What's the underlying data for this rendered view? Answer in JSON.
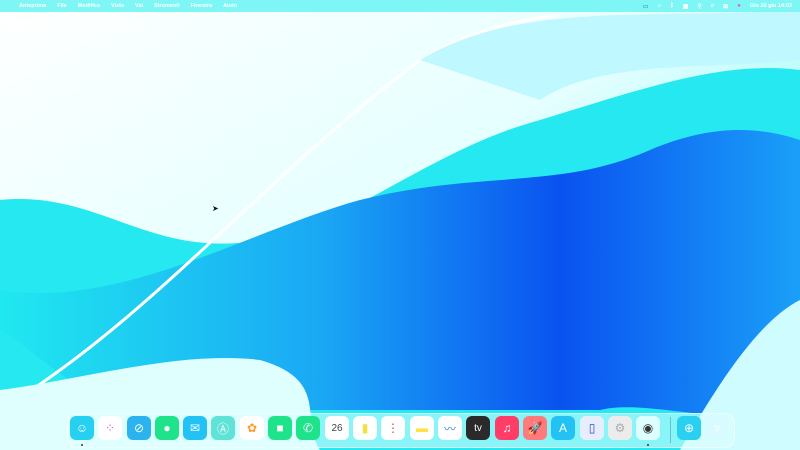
{
  "menubar": {
    "app_name": "Anteprima",
    "items": [
      "File",
      "Modifica",
      "Vista",
      "Vai",
      "Strumenti",
      "Finestra",
      "Aiuto"
    ],
    "clock": "Gio 26 giu  14:03",
    "status_icons": [
      "display-icon",
      "home-icon",
      "bluetooth-icon",
      "battery-icon",
      "wifi-icon",
      "search-icon",
      "control-center-icon",
      "siri-icon"
    ]
  },
  "dock": {
    "apps": [
      {
        "name": "Finder",
        "icon": "☺",
        "bg": "#26d0f0",
        "running": true
      },
      {
        "name": "Launchpad",
        "icon": "⁘",
        "bg": "#ffffff",
        "fg": "#e04fe0"
      },
      {
        "name": "Safari",
        "icon": "⊘",
        "bg": "#2ab3ef"
      },
      {
        "name": "Messaggi",
        "icon": "●",
        "bg": "#1fe38a"
      },
      {
        "name": "Mail",
        "icon": "✉",
        "bg": "#22c3f4"
      },
      {
        "name": "Mappe",
        "icon": "Ⓐ",
        "bg": "#5fe3d6"
      },
      {
        "name": "Foto",
        "icon": "✿",
        "bg": "#ffffff",
        "fg": "#ff9a2a"
      },
      {
        "name": "FaceTime",
        "icon": "■",
        "bg": "#1fe38a"
      },
      {
        "name": "Telefono",
        "icon": "✆",
        "bg": "#1fe38a"
      },
      {
        "name": "Calendario",
        "icon": "26",
        "bg": "#ffffff",
        "fg": "#444"
      },
      {
        "name": "Contatti",
        "icon": "▮",
        "bg": "#ffffff",
        "fg": "#f0e040"
      },
      {
        "name": "Promemoria",
        "icon": "⋮",
        "bg": "#ffffff",
        "fg": "#e04040"
      },
      {
        "name": "Note",
        "icon": "▬",
        "bg": "#ffffff",
        "fg": "#ffe14a"
      },
      {
        "name": "Freeform",
        "icon": "〰",
        "bg": "#ffffff",
        "fg": "#2f7fd8"
      },
      {
        "name": "TV",
        "icon": "tv",
        "bg": "#2a2a2a"
      },
      {
        "name": "Musica",
        "icon": "♫",
        "bg": "#ff3d66"
      },
      {
        "name": "Rocket",
        "icon": "🚀",
        "bg": "#ff7a7a"
      },
      {
        "name": "App Store",
        "icon": "A",
        "bg": "#22c3f4"
      },
      {
        "name": "iPhone Mirroring",
        "icon": "▯",
        "bg": "#e6eefc",
        "fg": "#2a4ad8"
      },
      {
        "name": "Impostazioni di Sistema",
        "icon": "⚙",
        "bg": "#ececec",
        "fg": "#aaa"
      },
      {
        "name": "Anteprima",
        "icon": "◉",
        "bg": "#dff",
        "fg": "#333",
        "running": true
      },
      {
        "name": "Download",
        "icon": "⊕",
        "bg": "#2ad0f0"
      },
      {
        "name": "Cestino",
        "icon": "▿",
        "bg": "#d8fbff",
        "fg": "#fff"
      }
    ]
  }
}
